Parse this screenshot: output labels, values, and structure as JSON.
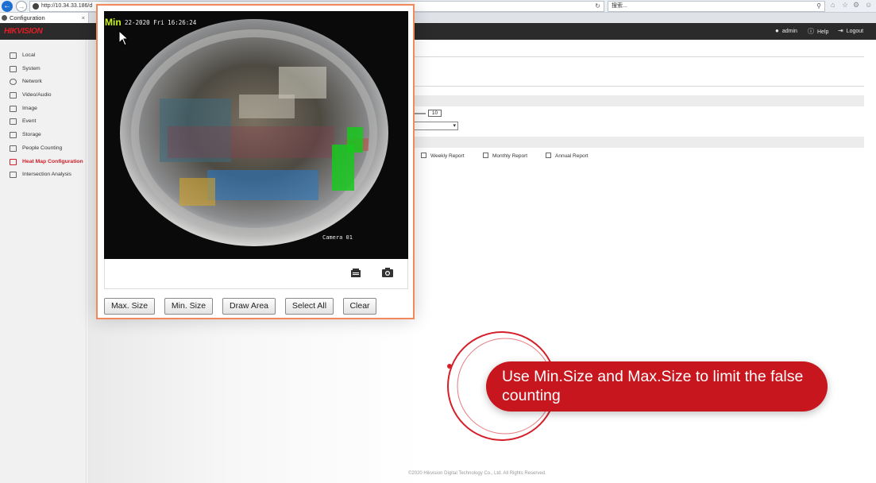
{
  "browser": {
    "url": "http://10.34.33.186/d",
    "search_placeholder": "搜索...",
    "tab_title": "Configuration"
  },
  "app": {
    "logo": "HIKVISION",
    "user": "admin",
    "help": "Help",
    "logout": "Logout"
  },
  "sidebar": {
    "items": [
      {
        "label": "Local",
        "icon": "monitor-icon"
      },
      {
        "label": "System",
        "icon": "system-icon"
      },
      {
        "label": "Network",
        "icon": "globe-icon"
      },
      {
        "label": "Video/Audio",
        "icon": "video-audio-icon"
      },
      {
        "label": "Image",
        "icon": "image-icon"
      },
      {
        "label": "Event",
        "icon": "calendar-icon"
      },
      {
        "label": "Storage",
        "icon": "storage-icon"
      },
      {
        "label": "People Counting",
        "icon": "people-icon"
      },
      {
        "label": "Heat Map Configuration",
        "icon": "heatmap-icon",
        "active": true
      },
      {
        "label": "Intersection Analysis",
        "icon": "intersection-icon"
      }
    ]
  },
  "main": {
    "sensitivity_value": "10",
    "reports": [
      "Weekly Report",
      "Monthly Report",
      "Annual Report"
    ],
    "footer": "©2020 Hikvision Digital Technology Co., Ltd. All Rights Reserved."
  },
  "video": {
    "osd_label": "Min",
    "osd_time": "22-2020 Fri 16:26:24",
    "camera_label": "Camera 01",
    "toolbar_icons": [
      "record-icon",
      "snapshot-icon"
    ]
  },
  "dialog_buttons": {
    "max_size": "Max. Size",
    "min_size": "Min. Size",
    "draw_area": "Draw Area",
    "select_all": "Select All",
    "clear": "Clear"
  },
  "callout": {
    "text": "Use Min.Size and Max.Size to limit the false counting"
  },
  "colors": {
    "brand_red": "#c8161e",
    "dialog_border": "#f08a5c",
    "detection_green": "#18c81e"
  }
}
